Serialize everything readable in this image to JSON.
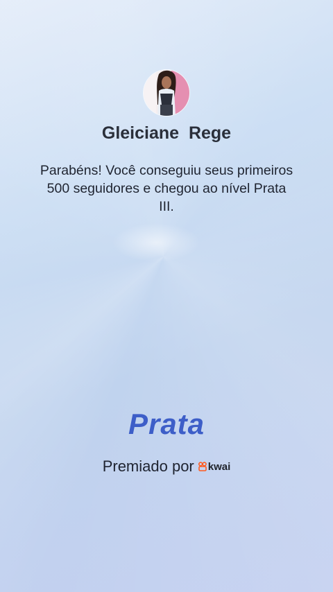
{
  "profile": {
    "name": "Gleiciane  Rege",
    "avatar_icon": "profile-photo"
  },
  "message": "Parabéns! Você conseguiu seus primeiros 500 seguidores e chegou ao nível Prata III.",
  "badge": {
    "level": "Prata",
    "color": "#3d5ec8"
  },
  "footer": {
    "awarded_by": "Premiado por",
    "brand": "kwai",
    "brand_icon": "kwai-logo-icon",
    "brand_color": "#ff5a1f"
  }
}
